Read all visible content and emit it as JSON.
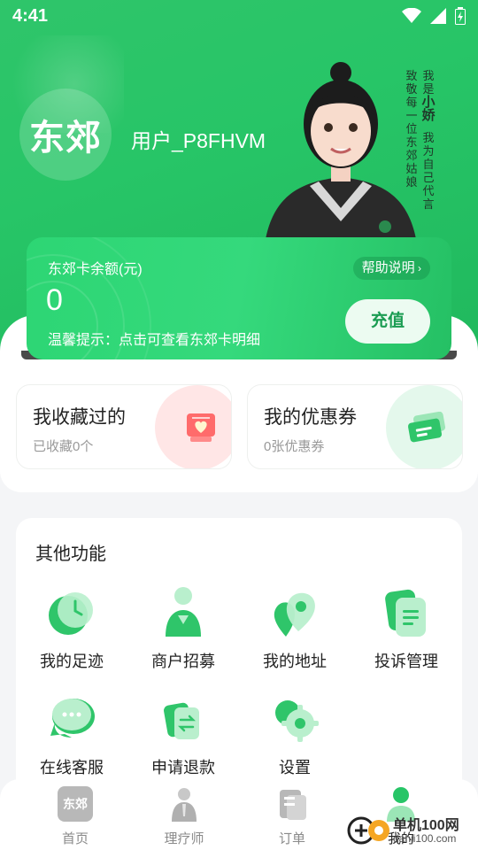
{
  "status_bar": {
    "time": "4:41"
  },
  "profile": {
    "logo_text": "东郊",
    "username": "用户_P8FHVM"
  },
  "slogan": {
    "col1": [
      "我",
      "是"
    ],
    "col1_bold": "小娇",
    "col1_tail": [
      "我",
      "为",
      "自",
      "己",
      "代",
      "言"
    ],
    "col2": [
      "致",
      "敬",
      "每",
      "一",
      "位",
      "东",
      "郊",
      "姑",
      "娘"
    ]
  },
  "card": {
    "title": "东郊卡余额(元)",
    "balance": "0",
    "help_label": "帮助说明",
    "tip": "温馨提示：点击可查看东郊卡明细",
    "recharge_label": "充值"
  },
  "tiles": [
    {
      "title": "我收藏过的",
      "sub": "已收藏0个"
    },
    {
      "title": "我的优惠券",
      "sub": "0张优惠券"
    }
  ],
  "functions": {
    "title": "其他功能",
    "items": [
      {
        "label": "我的足迹",
        "icon": "clock-icon"
      },
      {
        "label": "商户招募",
        "icon": "merchant-icon"
      },
      {
        "label": "我的地址",
        "icon": "location-icon"
      },
      {
        "label": "投诉管理",
        "icon": "document-icon"
      },
      {
        "label": "在线客服",
        "icon": "chat-icon"
      },
      {
        "label": "申请退款",
        "icon": "refund-icon"
      },
      {
        "label": "设置",
        "icon": "gear-icon"
      }
    ]
  },
  "nav": {
    "items": [
      {
        "label": "首页",
        "icon_text": "东郊"
      },
      {
        "label": "理疗师"
      },
      {
        "label": "订单"
      },
      {
        "label": "我的"
      }
    ]
  },
  "watermark": {
    "line1": "单机100网",
    "line2": "danji100.com"
  },
  "colors": {
    "brand_green": "#27c567",
    "accent_red": "#ff6b6b",
    "text_dark": "#222222",
    "text_muted": "#999999"
  }
}
